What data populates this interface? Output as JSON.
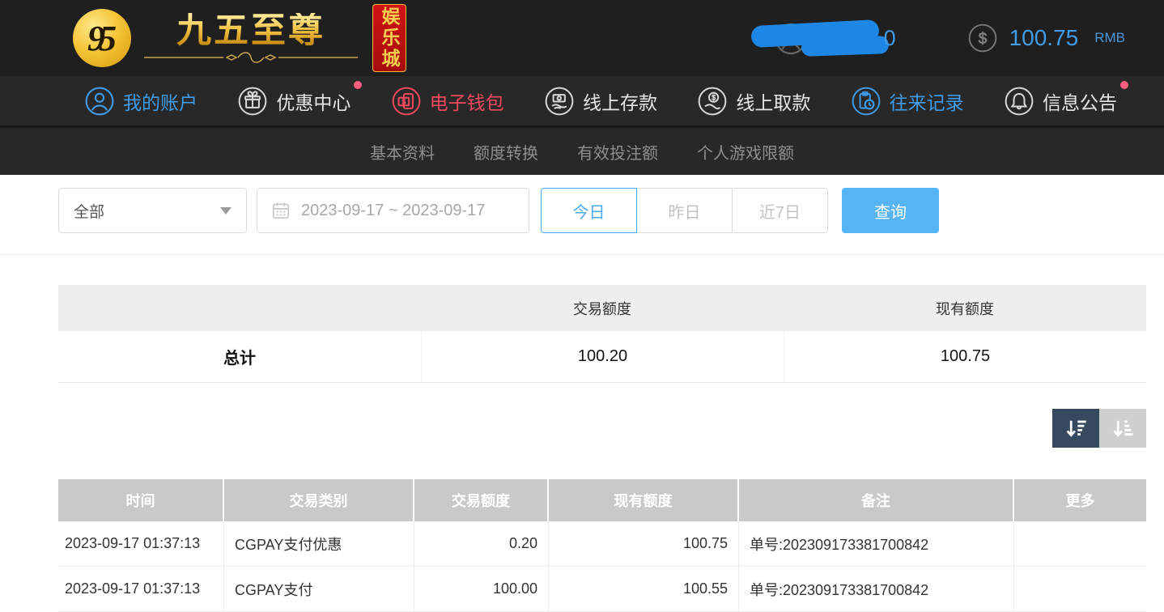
{
  "colors": {
    "accent_blue": "#3f9ce8",
    "accent_pink": "#f4485f",
    "badge_pink": "#fb5f80",
    "button_blue": "#57b4f2",
    "active_range_blue": "#4aa9ee",
    "topbar_bg": "#1f1f1f",
    "nav_bg": "#282828",
    "table_header_gray": "#c9c9c9",
    "summary_header_gray": "#eeeeee",
    "sort_active_bg": "#36495e",
    "sort_inactive_bg": "#cfcfcf",
    "brand_gold": "#f2c243",
    "brand_red": "#c01111",
    "scribble_blue": "#1d87e6"
  },
  "topbar": {
    "logo": {
      "monogram": "95",
      "brand": "九五至尊",
      "suffix_vertical": "娱乐城"
    },
    "user": {
      "visible_suffix": "0",
      "icon": "avatar-icon"
    },
    "balance": {
      "icon": "dollar-circle-icon",
      "amount": "100.75",
      "currency": "RMB"
    }
  },
  "nav": {
    "items": [
      {
        "label": "我的账户",
        "icon": "user-circle-icon",
        "state": "blue",
        "badge": false
      },
      {
        "label": "优惠中心",
        "icon": "gift-icon",
        "state": "default",
        "badge": true
      },
      {
        "label": "电子钱包",
        "icon": "wallet-icon",
        "state": "pink",
        "badge": false
      },
      {
        "label": "线上存款",
        "icon": "deposit-icon",
        "state": "default",
        "badge": false
      },
      {
        "label": "线上取款",
        "icon": "withdraw-icon",
        "state": "default",
        "badge": false
      },
      {
        "label": "往来记录",
        "icon": "records-icon",
        "state": "blue",
        "badge": false
      },
      {
        "label": "信息公告",
        "icon": "bell-icon",
        "state": "default",
        "badge": true
      }
    ]
  },
  "subnav": {
    "items": [
      "基本资料",
      "额度转换",
      "有效投注额",
      "个人游戏限额"
    ]
  },
  "filters": {
    "type_select": {
      "value": "全部",
      "icon": "caret-down-icon"
    },
    "date_range": {
      "value": "2023-09-17 ~ 2023-09-17",
      "icon": "calendar-icon"
    },
    "quick_ranges": [
      {
        "label": "今日",
        "active": true
      },
      {
        "label": "昨日",
        "active": false
      },
      {
        "label": "近7日",
        "active": false
      }
    ],
    "search_button": "查询"
  },
  "summary_table": {
    "headers": [
      "",
      "交易额度",
      "现有额度"
    ],
    "row": {
      "label": "总计",
      "transaction_amount": "100.20",
      "current_amount": "100.75"
    }
  },
  "sort_controls": {
    "icons": [
      "sort-desc-icon",
      "sort-asc-icon"
    ]
  },
  "records_table": {
    "headers": [
      "时间",
      "交易类别",
      "交易额度",
      "现有额度",
      "备注",
      "更多"
    ],
    "rows": [
      {
        "time": "2023-09-17 01:37:13",
        "type": "CGPAY支付优惠",
        "amount": "0.20",
        "balance": "100.75",
        "remark": "单号:202309173381700842",
        "more": ""
      },
      {
        "time": "2023-09-17 01:37:13",
        "type": "CGPAY支付",
        "amount": "100.00",
        "balance": "100.55",
        "remark": "单号:202309173381700842",
        "more": ""
      }
    ]
  }
}
